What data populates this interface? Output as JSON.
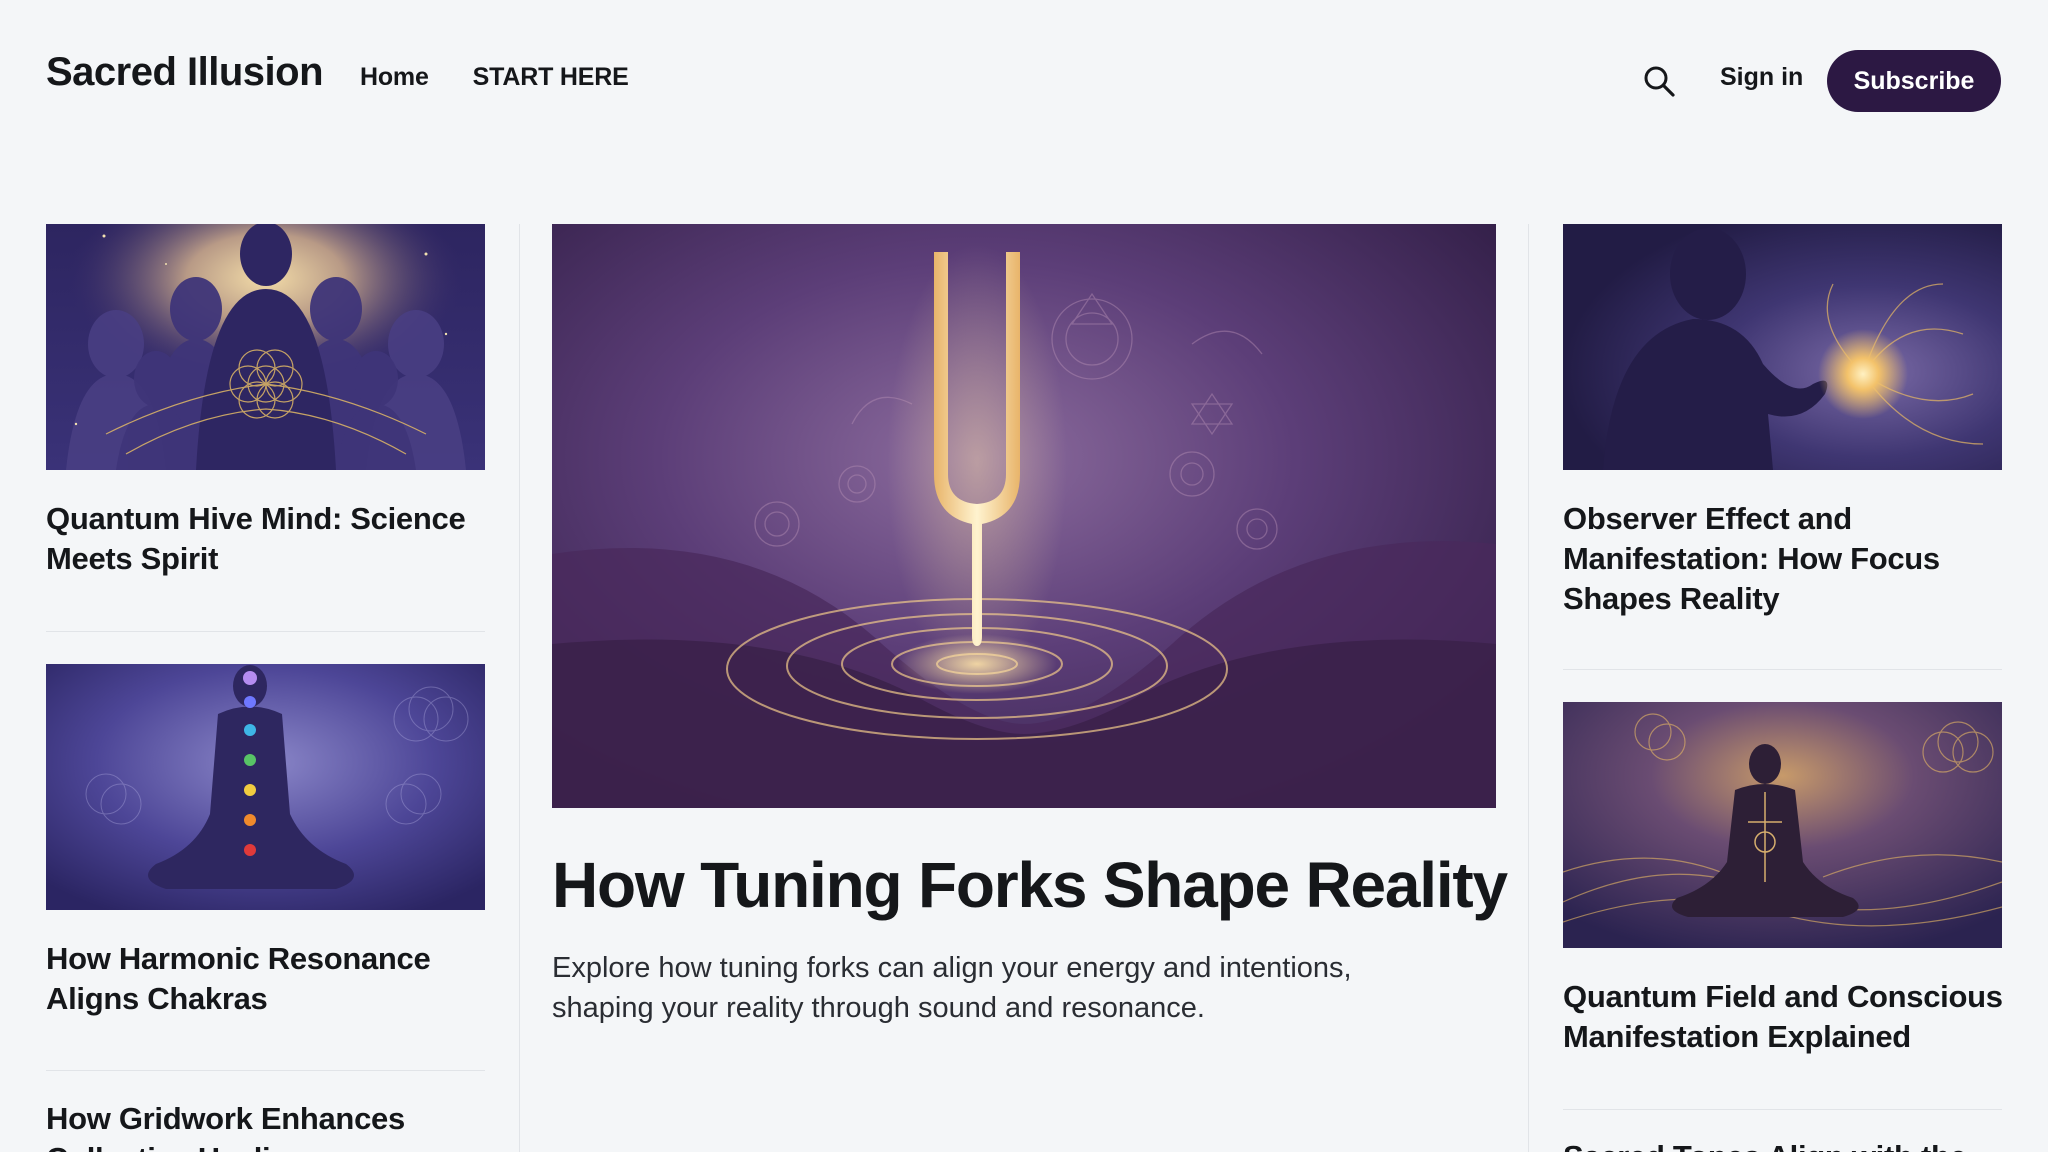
{
  "site": {
    "title": "Sacred Illusion"
  },
  "nav": {
    "items": [
      {
        "label": "Home"
      },
      {
        "label": "START HERE"
      }
    ]
  },
  "header_actions": {
    "search_icon": "search-icon",
    "signin_label": "Sign in",
    "subscribe_label": "Subscribe"
  },
  "colors": {
    "background": "#f4f6f8",
    "accent": "#2c1843",
    "text": "#15171a"
  },
  "left_column": [
    {
      "title": "Quantum Hive Mind: Science Meets Spirit",
      "image": "silhouettes-sacred-geometry"
    },
    {
      "title": "How Harmonic Resonance Aligns Chakras",
      "image": "meditating-figure-chakras"
    },
    {
      "title": "How Gridwork Enhances Collective Healing",
      "image": ""
    }
  ],
  "feature": {
    "title": "How Tuning Forks Shape Reality",
    "excerpt": "Explore how tuning forks can align your energy and intentions, shaping your reality through sound and resonance.",
    "image": "glowing-tuning-fork"
  },
  "right_column": [
    {
      "title": "Observer Effect and Manifestation: How Focus Shapes Reality",
      "image": "man-with-glowing-orb"
    },
    {
      "title": "Quantum Field and Conscious Manifestation Explained",
      "image": "meditating-golden-figure"
    },
    {
      "title": "Sacred Tones Align with the",
      "image": ""
    }
  ]
}
